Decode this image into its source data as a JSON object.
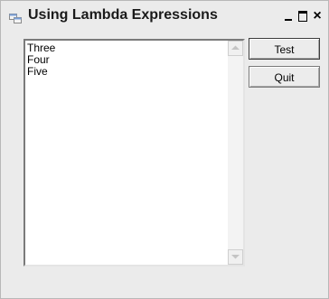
{
  "window": {
    "title": "Using Lambda Expressions",
    "caption": {
      "close_glyph": "×"
    }
  },
  "listbox": {
    "items": [
      "Three",
      "Four",
      "Five"
    ]
  },
  "buttons": {
    "test_label": "Test",
    "quit_label": "Quit"
  }
}
